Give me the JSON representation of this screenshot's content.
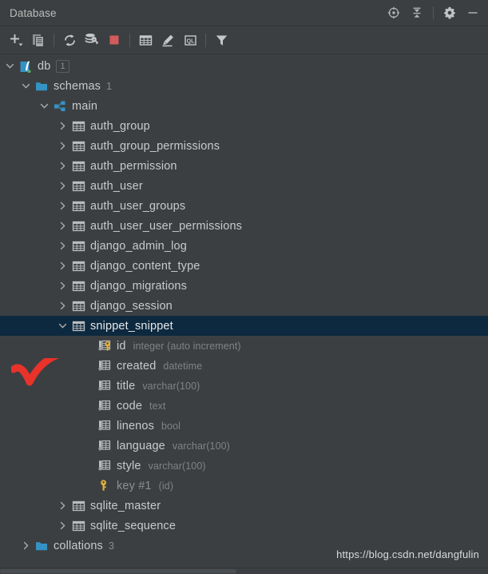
{
  "window": {
    "title": "Database",
    "actions": [
      {
        "name": "scroll-from-source-icon",
        "label": "Scroll from Source"
      },
      {
        "name": "collapse-all-icon",
        "label": "Collapse All"
      },
      {
        "name": "settings-gear-icon",
        "label": "Settings"
      },
      {
        "name": "minimize-icon",
        "label": "Hide"
      }
    ]
  },
  "toolbar": {
    "buttons": [
      {
        "name": "add-new-button",
        "label": "New"
      },
      {
        "name": "duplicate-button",
        "label": "Duplicate"
      },
      {
        "name": "refresh-button",
        "label": "Refresh"
      },
      {
        "name": "sync-schema-button",
        "label": "Synchronize"
      },
      {
        "name": "stop-button",
        "label": "Stop"
      },
      {
        "name": "open-data-editor-button",
        "label": "Data Editor"
      },
      {
        "name": "modify-object-button",
        "label": "Modify"
      },
      {
        "name": "open-query-console-button",
        "label": "QL"
      },
      {
        "name": "filter-button",
        "label": "Filter"
      }
    ]
  },
  "tree": {
    "nodes": [
      {
        "name": "db",
        "label": "db",
        "badge": "1",
        "icon": "datasource-icon",
        "indent": 0,
        "expanded": true,
        "type": "datasource"
      },
      {
        "name": "schemas",
        "label": "schemas",
        "count": "1",
        "icon": "folder-icon",
        "indent": 1,
        "expanded": true,
        "type": "folder"
      },
      {
        "name": "main",
        "label": "main",
        "icon": "schema-icon",
        "indent": 2,
        "expanded": true,
        "type": "schema"
      },
      {
        "name": "auth_group",
        "label": "auth_group",
        "icon": "table-icon",
        "indent": 3,
        "expanded": false,
        "type": "table"
      },
      {
        "name": "auth_group_permissions",
        "label": "auth_group_permissions",
        "icon": "table-icon",
        "indent": 3,
        "expanded": false,
        "type": "table"
      },
      {
        "name": "auth_permission",
        "label": "auth_permission",
        "icon": "table-icon",
        "indent": 3,
        "expanded": false,
        "type": "table"
      },
      {
        "name": "auth_user",
        "label": "auth_user",
        "icon": "table-icon",
        "indent": 3,
        "expanded": false,
        "type": "table"
      },
      {
        "name": "auth_user_groups",
        "label": "auth_user_groups",
        "icon": "table-icon",
        "indent": 3,
        "expanded": false,
        "type": "table"
      },
      {
        "name": "auth_user_user_permissions",
        "label": "auth_user_user_permissions",
        "icon": "table-icon",
        "indent": 3,
        "expanded": false,
        "type": "table"
      },
      {
        "name": "django_admin_log",
        "label": "django_admin_log",
        "icon": "table-icon",
        "indent": 3,
        "expanded": false,
        "type": "table"
      },
      {
        "name": "django_content_type",
        "label": "django_content_type",
        "icon": "table-icon",
        "indent": 3,
        "expanded": false,
        "type": "table"
      },
      {
        "name": "django_migrations",
        "label": "django_migrations",
        "icon": "table-icon",
        "indent": 3,
        "expanded": false,
        "type": "table"
      },
      {
        "name": "django_session",
        "label": "django_session",
        "icon": "table-icon",
        "indent": 3,
        "expanded": false,
        "type": "table"
      },
      {
        "name": "snippet_snippet",
        "label": "snippet_snippet",
        "icon": "table-icon",
        "indent": 3,
        "expanded": true,
        "selected": true,
        "type": "table"
      },
      {
        "name": "column-id",
        "label": "id",
        "sub": "integer (auto increment)",
        "icon": "column-key-icon",
        "indent": 4,
        "type": "column"
      },
      {
        "name": "column-created",
        "label": "created",
        "sub": "datetime",
        "icon": "column-icon",
        "indent": 4,
        "type": "column"
      },
      {
        "name": "column-title",
        "label": "title",
        "sub": "varchar(100)",
        "icon": "column-icon",
        "indent": 4,
        "type": "column"
      },
      {
        "name": "column-code",
        "label": "code",
        "sub": "text",
        "icon": "column-icon",
        "indent": 4,
        "type": "column"
      },
      {
        "name": "column-linenos",
        "label": "linenos",
        "sub": "bool",
        "icon": "column-icon",
        "indent": 4,
        "type": "column"
      },
      {
        "name": "column-language",
        "label": "language",
        "sub": "varchar(100)",
        "icon": "column-icon",
        "indent": 4,
        "type": "column"
      },
      {
        "name": "column-style",
        "label": "style",
        "sub": "varchar(100)",
        "icon": "column-icon",
        "indent": 4,
        "type": "column"
      },
      {
        "name": "key-1",
        "label": "key #1",
        "sub": "(id)",
        "icon": "key-icon",
        "indent": 4,
        "type": "key",
        "dim": true
      },
      {
        "name": "sqlite_master",
        "label": "sqlite_master",
        "icon": "table-icon",
        "indent": 3,
        "expanded": false,
        "type": "table"
      },
      {
        "name": "sqlite_sequence",
        "label": "sqlite_sequence",
        "icon": "table-icon",
        "indent": 3,
        "expanded": false,
        "type": "table"
      },
      {
        "name": "collations",
        "label": "collations",
        "count": "3",
        "icon": "folder-icon",
        "indent": 1,
        "expanded": false,
        "type": "folder"
      }
    ]
  },
  "annotation": {
    "name": "red-check-mark",
    "shape": "checkmark",
    "color": "#e8322a"
  },
  "watermark": {
    "text": "https://blog.csdn.net/dangfulin"
  },
  "colors": {
    "background": "#3c3f41",
    "selection": "#0d293f",
    "text": "#c8cacb",
    "muted": "#808386",
    "accent_blue": "#3592c4",
    "key_gold": "#e4b33a",
    "stop_red": "#d45b5b"
  }
}
